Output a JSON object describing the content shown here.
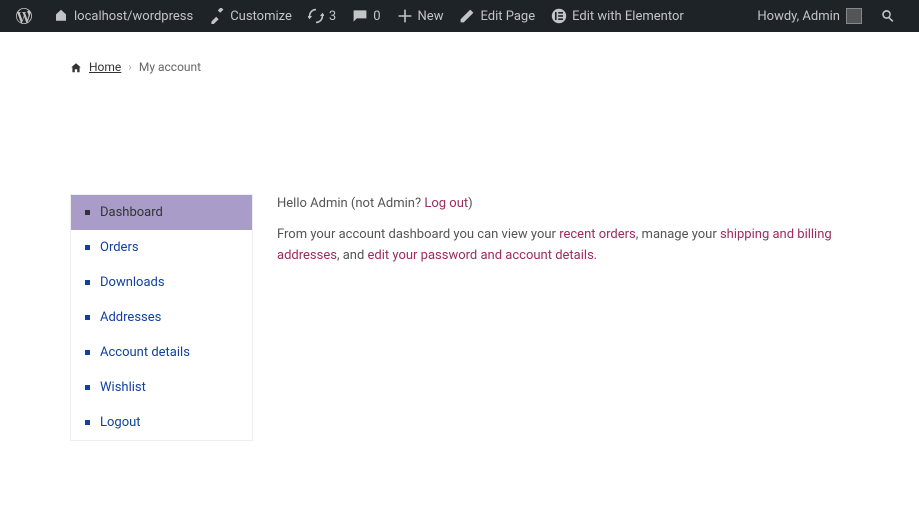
{
  "adminbar": {
    "site": "localhost/wordpress",
    "customize": "Customize",
    "updates": "3",
    "comments": "0",
    "new": "New",
    "editpage": "Edit Page",
    "elementor": "Edit with Elementor",
    "howdy": "Howdy, Admin"
  },
  "breadcrumb": {
    "home": "Home",
    "current": "My account"
  },
  "nav": [
    {
      "label": "Dashboard",
      "active": true
    },
    {
      "label": "Orders",
      "active": false
    },
    {
      "label": "Downloads",
      "active": false
    },
    {
      "label": "Addresses",
      "active": false
    },
    {
      "label": "Account details",
      "active": false
    },
    {
      "label": "Wishlist",
      "active": false
    },
    {
      "label": "Logout",
      "active": false
    }
  ],
  "main": {
    "hello_pre": "Hello Admin (not Admin? ",
    "logout": "Log out",
    "hello_post": ")",
    "p2_a": "From your account dashboard you can view your ",
    "recent": "recent orders",
    "p2_b": ", manage your ",
    "shipping": "shipping and billing addresses",
    "p2_c": ", and ",
    "edit": "edit your password and account details",
    "p2_d": "."
  }
}
